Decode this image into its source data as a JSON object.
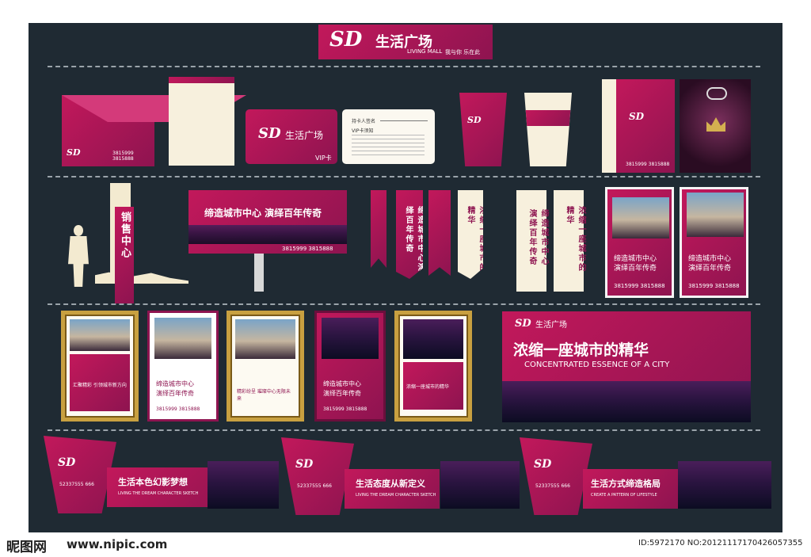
{
  "header": {
    "logo_mark": "SD",
    "brand_name": "生活广场",
    "brand_en": "LIVING MALL",
    "brand_slogan": "我与你 乐在此"
  },
  "stationery": {
    "envelope_phone": "3815999 3815888",
    "card_vip": "VIP卡",
    "card_back_title": "持卡人签名",
    "card_back_subtitle": "VIP卡须知",
    "bag_phone": "3815999 3815888"
  },
  "signage": {
    "sales_center": "销售中心",
    "billboard_text": "缔造城市中心 演绎百年传奇",
    "billboard_phone": "3815999 3815888",
    "flag_1": "缔造城市中心演绎百年传奇",
    "flag_2": "浓缩一座城市的精华",
    "rollup_1": "缔造城市中心演绎百年传奇",
    "rollup_2": "浓缩一座城市的精华",
    "poster_text_line1": "缔造城市中心",
    "poster_text_line2": "演绎百年传奇",
    "poster_phone": "3815999 3815888"
  },
  "frames": {
    "frame1_line": "汇聚精彩 引领城市新方向",
    "frame2_line1": "缔造城市中心",
    "frame2_line2": "演绎百年传奇",
    "frame3_line": "精彩纷呈 璀璨中心无限未来",
    "frame4_line1": "缔造城市中心",
    "frame4_line2": "演绎百年传奇",
    "frame5_line": "浓缩一座城市的精华",
    "phone": "3815999 3815888"
  },
  "banner": {
    "headline": "浓缩一座城市的精华",
    "subline": "CONCENTRATED ESSENCE OF A CITY"
  },
  "hoardings": [
    {
      "title": "生活本色幻影梦想",
      "subtitle": "LIVING THE DREAM CHARACTER SKETCH",
      "phone": "52337555 666"
    },
    {
      "title": "生活态度从新定义",
      "subtitle": "LIVING THE DREAM CHARACTER SKETCH",
      "phone": "52337555 666"
    },
    {
      "title": "生活方式缔造格局",
      "subtitle": "CREATE A PATTERN OF LIFESTYLE",
      "phone": "52337555 666"
    }
  ],
  "footer": {
    "site_logo": "昵图网",
    "site_url": "www.nipic.com",
    "id_text": "ID:5972170 NO:20121117170426057355"
  },
  "colors": {
    "board": "#1f2a33",
    "magenta": "#b0175a",
    "cream": "#f7f0dd",
    "gold": "#c8a040"
  }
}
